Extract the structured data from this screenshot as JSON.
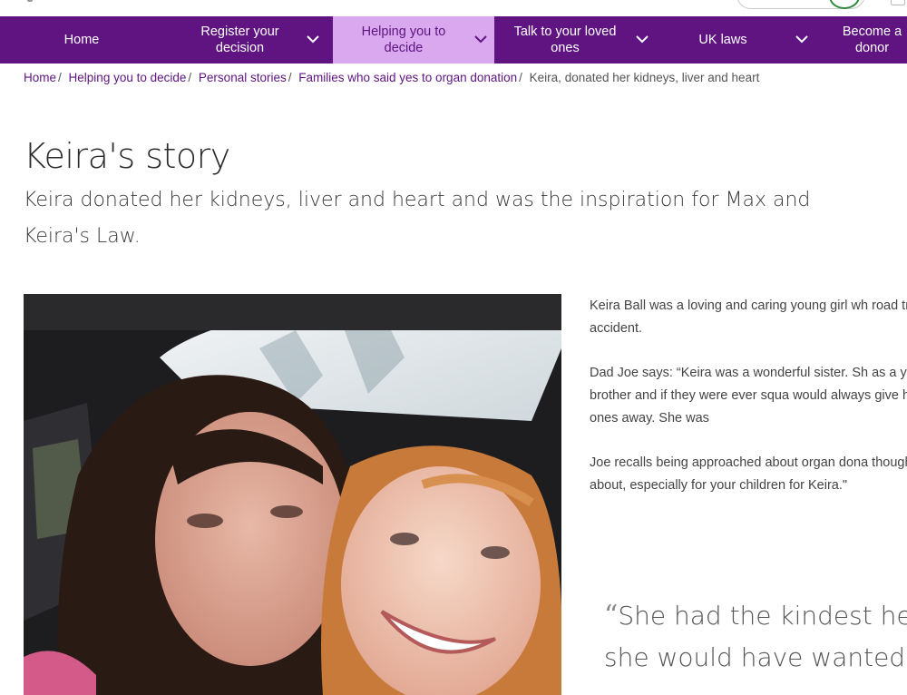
{
  "nav": {
    "items": [
      {
        "label": "Home",
        "has_dropdown": false,
        "active": false
      },
      {
        "label": "Register your decision",
        "has_dropdown": true,
        "active": false
      },
      {
        "label": "Helping you to decide",
        "has_dropdown": true,
        "active": true
      },
      {
        "label": "Talk to your loved ones",
        "has_dropdown": true,
        "active": false
      },
      {
        "label": "UK laws",
        "has_dropdown": true,
        "active": false
      },
      {
        "label": "Become a donor",
        "has_dropdown": false,
        "active": false
      }
    ]
  },
  "breadcrumb": {
    "items": [
      "Home",
      "Helping you to decide",
      "Personal stories",
      "Families who said yes to organ donation"
    ],
    "current": "Keira, donated her kidneys, liver and heart"
  },
  "page": {
    "title": "Keira's story",
    "subtitle": "Keira donated her kidneys, liver and heart and was the inspiration for Max and Keira's Law."
  },
  "body": {
    "paragraphs": [
      "Keira Ball was a loving and caring young girl wh road traffic accident.",
      "Dad Joe says: “Keira was a wonderful sister. Sh as a younger brother and if they were ever squa would always give her last ones away. She was",
      "Joe recalls being approached about organ dona thought much about, especially for your children for Keira.\""
    ],
    "quote_line1": "She had the kindest he",
    "quote_line2": "she would have wanted t",
    "quote_mark": "“"
  },
  "colors": {
    "nav_bg": "#5f1481",
    "nav_active_bg": "#d9a8ee",
    "link": "#5f1481"
  }
}
